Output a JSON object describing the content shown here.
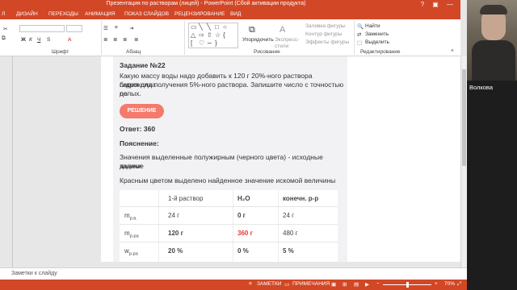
{
  "window": {
    "title": "Презентация по растворам (лицей) - PowerPoint (Сбой активации продукта)",
    "controls": [
      "?",
      "▣",
      "—"
    ]
  },
  "ribbon_tabs": [
    "Л",
    "ДИЗАЙН",
    "ПЕРЕХОДЫ",
    "АНИМАЦИЯ",
    "ПОКАЗ СЛАЙДОВ",
    "РЕЦЕНЗИРОВАНИЕ",
    "ВИД"
  ],
  "ribbon": {
    "groups": {
      "font": "Шрифт",
      "paragraph": "Абзац",
      "drawing": "Рисование",
      "editing": "Редактирование"
    },
    "arrange_label": "Упорядочить",
    "quick_styles_label": "Экспресс-стили",
    "shape_fill": "Заливка фигуры",
    "shape_outline": "Контур фигуры",
    "shape_effects": "Эффекты фигуры",
    "find": "Найти",
    "replace": "Заменить",
    "select": "Выделить"
  },
  "slide": {
    "task_title": "Задание №22",
    "task_text": [
      "Какую массу воды надо добавить к 120 г 20%-ного раствора  гидроксида",
      "бария для получения 5%-ного раствора. Запишите число с точностью до",
      "целых."
    ],
    "solution_button": "РЕШЕНИЕ",
    "answer": "Ответ: 360",
    "explanation_title": "Пояснение:",
    "explanation_text": [
      "Значения выделенные полужирным (черного цвета) - исходные данные",
      "задачи"
    ],
    "red_note": "Красным цветом выделено найденное значение искомой величины",
    "table": {
      "headers": [
        "",
        "1-й раствор",
        "H₂O",
        "конечн. р-р"
      ],
      "rows": [
        {
          "label": "m",
          "sub": "р.в.",
          "c1": "24 г",
          "c2": "0 г",
          "c3": "24 г"
        },
        {
          "label": "m",
          "sub": "р-ра",
          "c1": "120 г",
          "c2": "360 г",
          "c3": "480 г"
        },
        {
          "label": "w",
          "sub": "р-ра",
          "c1": "20 %",
          "c2": "0 %",
          "c3": "5 %"
        }
      ]
    }
  },
  "notes": "Заметки к слайду",
  "status": {
    "notes_btn": "ЗАМЕТКИ",
    "comments_btn": "ПРИМЕЧАНИЯ",
    "zoom": "70%"
  },
  "video": {
    "name": "Волкова"
  },
  "colors": {
    "accent": "#d24726",
    "solution_button": "#f47a6b",
    "found_value": "#e53935"
  }
}
